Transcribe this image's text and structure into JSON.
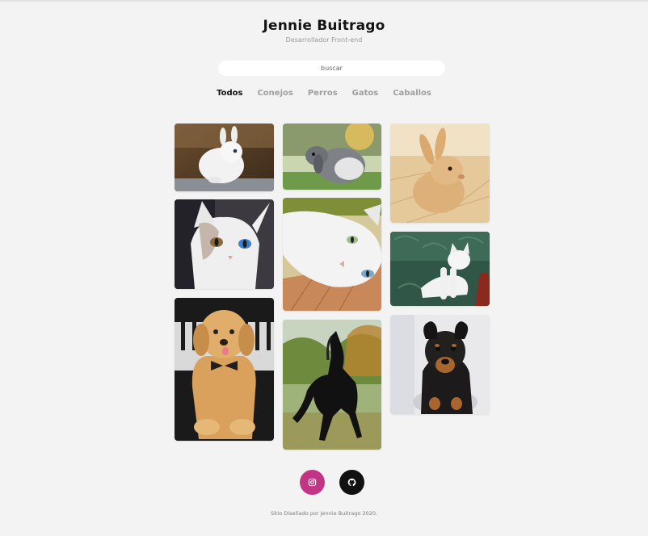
{
  "header": {
    "title": "Jennie Buitrago",
    "subtitle": "Desarrollador Front-end"
  },
  "search": {
    "placeholder": "buscar",
    "value": ""
  },
  "filters": [
    {
      "label": "Todos",
      "active": true
    },
    {
      "label": "Conejos",
      "active": false
    },
    {
      "label": "Perros",
      "active": false
    },
    {
      "label": "Gatos",
      "active": false
    },
    {
      "label": "Caballos",
      "active": false
    }
  ],
  "gallery": [
    {
      "alt": "white bunny",
      "category": "Conejos"
    },
    {
      "alt": "grey lop rabbit",
      "category": "Conejos"
    },
    {
      "alt": "tan rabbit in straw",
      "category": "Conejos"
    },
    {
      "alt": "white cat with odd eyes",
      "category": "Gatos"
    },
    {
      "alt": "white cat lying down",
      "category": "Gatos"
    },
    {
      "alt": "white cat on green sofa",
      "category": "Gatos"
    },
    {
      "alt": "golden retriever puppy with bow tie",
      "category": "Perros"
    },
    {
      "alt": "black horse galloping",
      "category": "Caballos"
    },
    {
      "alt": "black and tan dachshund puppy",
      "category": "Perros"
    }
  ],
  "social": {
    "instagram_icon": "instagram-icon",
    "github_icon": "github-icon",
    "instagram_color": "#c13584",
    "github_color": "#111111"
  },
  "footer": {
    "text": "Sitio Diseñado por Jennie Buitrago 2020."
  }
}
